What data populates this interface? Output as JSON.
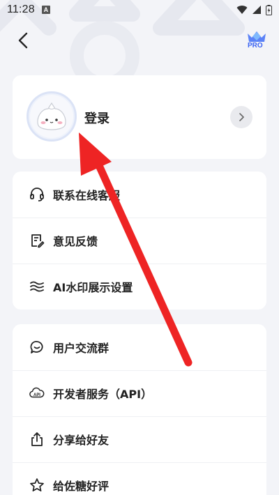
{
  "status_bar": {
    "time": "11:28",
    "app_badge": "A",
    "icons": [
      "wifi-icon",
      "signal-icon",
      "battery-icon"
    ]
  },
  "nav": {
    "back_icon": "back-arrow-icon",
    "pro_label": "PRO",
    "pro_icon": "crown-icon"
  },
  "profile": {
    "login_label": "登录",
    "avatar_icon": "bun-mascot-avatar",
    "action_icon": "chevron-right-icon"
  },
  "menu_group_1": [
    {
      "label": "联系在线客服",
      "icon": "headset-icon"
    },
    {
      "label": "意见反馈",
      "icon": "feedback-note-icon"
    },
    {
      "label": "AI水印展示设置",
      "icon": "waves-icon"
    }
  ],
  "menu_group_2": [
    {
      "label": "用户交流群",
      "icon": "chat-bubble-icon"
    },
    {
      "label": "开发者服务（API）",
      "icon": "api-cloud-icon"
    },
    {
      "label": "分享给好友",
      "icon": "share-icon"
    },
    {
      "label": "给佐糖好评",
      "icon": "star-icon"
    }
  ],
  "colors": {
    "background": "#f3f4f8",
    "card": "#ffffff",
    "pro_accent": "#3b63f2",
    "crown": "#4d7cf6",
    "annotation_arrow": "#ee2424"
  }
}
